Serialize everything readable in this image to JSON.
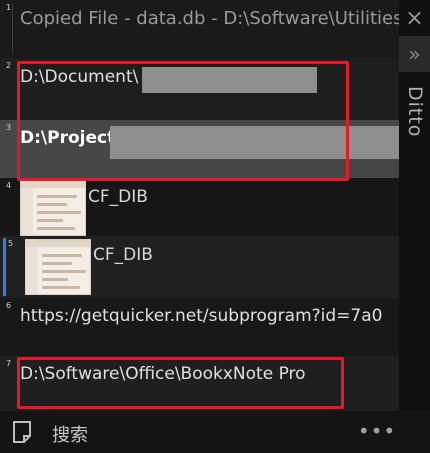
{
  "clips": [
    {
      "index": "1",
      "text": "Copied File - data.db - D:\\Software\\Utilities"
    },
    {
      "index": "2",
      "text": "D:\\Document\\"
    },
    {
      "index": "3",
      "text": "D:\\Projects"
    },
    {
      "index": "4",
      "text": "CF_DIB"
    },
    {
      "index": "5",
      "text": "CF_DIB"
    },
    {
      "index": "6",
      "text": "https://getquicker.net/subprogram?id=7a0"
    },
    {
      "index": "7",
      "text": "D:\\Software\\Office\\BookxNote Pro"
    }
  ],
  "side": {
    "close_icon": "×",
    "expand_icon": "»",
    "brand": "Ditto"
  },
  "bottom": {
    "search_label": "搜索",
    "more_icon": "•••"
  },
  "colors": {
    "accent": "#2f7ee6",
    "highlight": "#e5192b",
    "selected_row": "#474747"
  }
}
